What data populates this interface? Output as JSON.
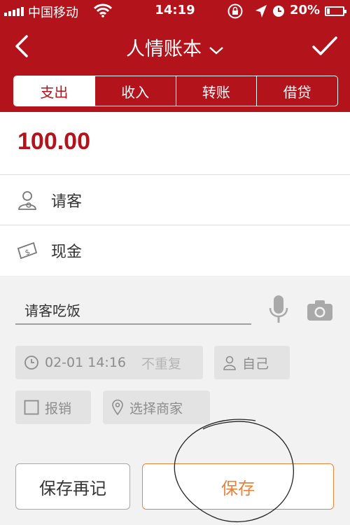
{
  "status_bar": {
    "carrier": "中国移动",
    "time": "14:19",
    "battery_percent": "20%",
    "battery_level": 0.2
  },
  "nav": {
    "title": "人情账本",
    "back_icon": "chevron-left-icon",
    "confirm_icon": "checkmark-icon"
  },
  "tabs": [
    {
      "label": "支出",
      "active": true
    },
    {
      "label": "收入",
      "active": false
    },
    {
      "label": "转账",
      "active": false
    },
    {
      "label": "借贷",
      "active": false
    }
  ],
  "amount": "100.00",
  "fields": {
    "category": {
      "label": "请客",
      "icon": "person-icon"
    },
    "account": {
      "label": "现金",
      "icon": "cash-icon"
    }
  },
  "note": {
    "value": "请客吃饭"
  },
  "chips": {
    "datetime": "02-01 14:16",
    "repeat": "不重复",
    "member": "自己",
    "reimburse": "报销",
    "merchant": "选择商家"
  },
  "buttons": {
    "save_again": "保存再记",
    "save": "保存"
  },
  "colors": {
    "brand_red": "#b3141c",
    "save_orange": "#e7823a"
  }
}
